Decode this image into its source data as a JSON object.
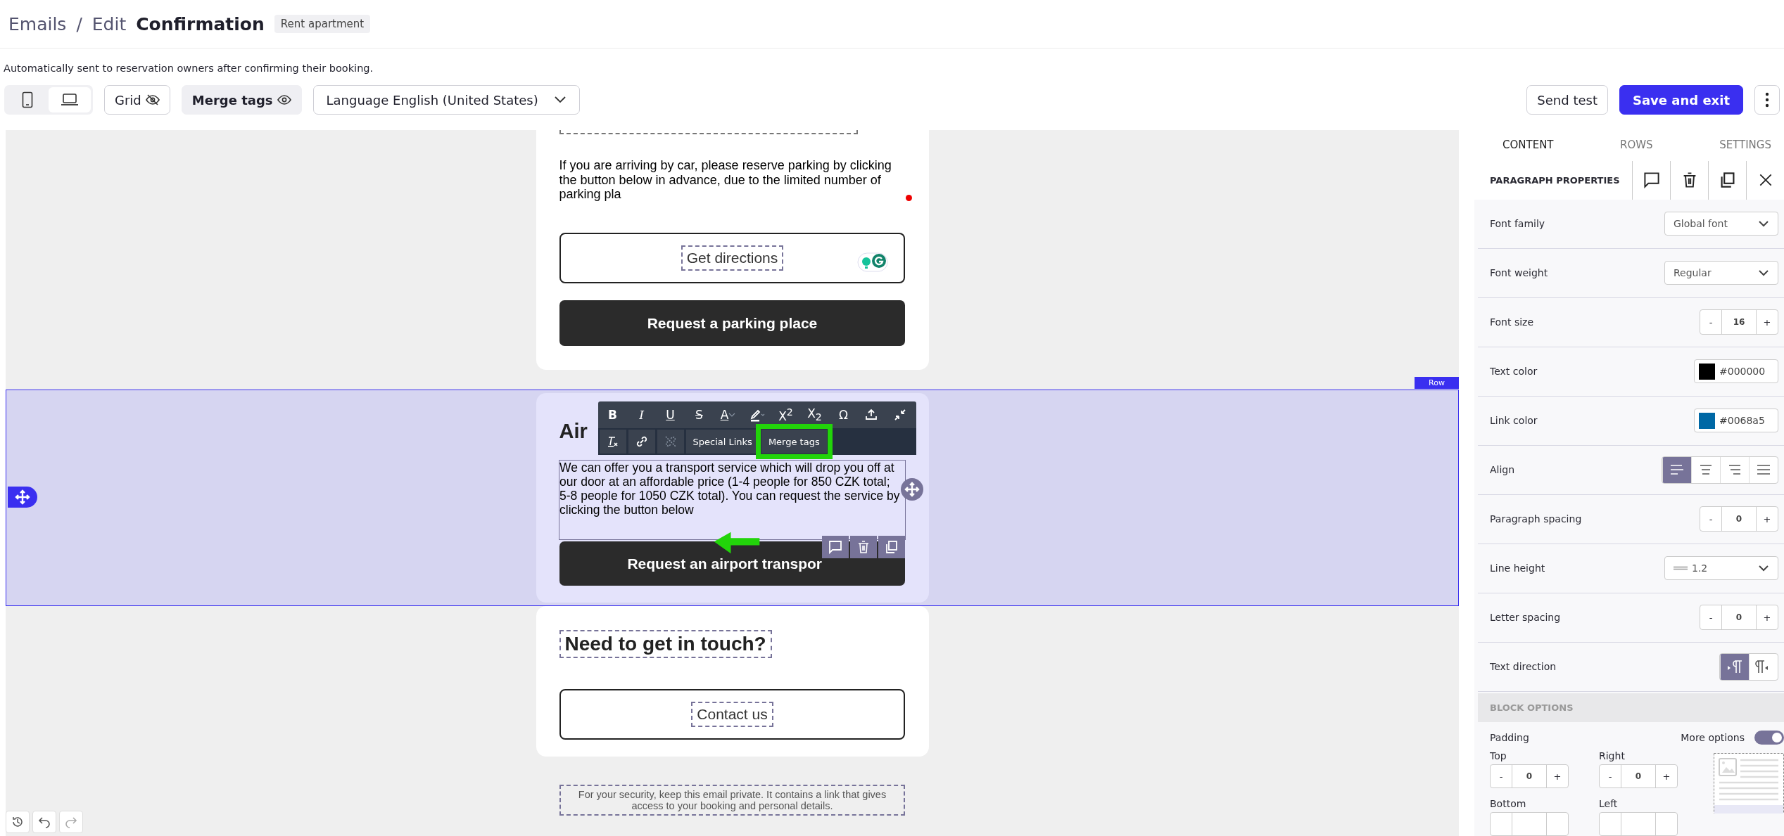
{
  "header": {
    "breadcrumb": [
      "Emails",
      "/",
      "Edit"
    ],
    "title": "Confirmation",
    "tag": "Rent apartment",
    "description": "Automatically sent to reservation owners after confirming their booking."
  },
  "toolbar": {
    "views": [
      {
        "kind": "mobile",
        "selected": false
      },
      {
        "kind": "desktop",
        "selected": true
      }
    ],
    "grid": {
      "label": "Grid",
      "on": false
    },
    "merge_tags": {
      "label": "Merge tags",
      "on": true
    },
    "language": "Language English (United States)",
    "send_test": "Send test",
    "save": "Save and exit"
  },
  "canvas": {
    "parking_text": "If you are arriving by car, please reserve parking by clicking the button below in advance, due to the limited number of parking pla",
    "directions_button": "Get directions",
    "parking_button": "Request a parking place",
    "row_label": "Row",
    "airport_heading": "Air",
    "airport_text": "We can offer you a transport service which will drop you off at our door at an affordable price (1-4 people for 850 CZK total; 5-8 people for 1050 CZK total). You can request the service by clicking the button below",
    "airport_button": "Request an airport transpor",
    "contact_heading": "Need to get in touch?",
    "contact_button": "Contact us",
    "footer_note": "For your security, keep this email private. It contains a link that gives access to your booking and personal details."
  },
  "format_toolbar": {
    "row_1": [
      {
        "kind": "bold",
        "label": "B"
      },
      {
        "kind": "italic",
        "label": "I"
      },
      {
        "kind": "underline",
        "label": "U"
      },
      {
        "kind": "strike",
        "label": "S"
      },
      {
        "kind": "text-color",
        "label": "A"
      },
      {
        "kind": "highlight"
      },
      {
        "kind": "superscript",
        "label": "X$^{2}$"
      },
      {
        "kind": "subscript",
        "label": "X$_{2}$"
      },
      {
        "kind": "special-char",
        "label": "Ω"
      },
      {
        "kind": "insert"
      },
      {
        "kind": "collapse"
      }
    ],
    "row_2": [
      {
        "kind": "clear"
      },
      {
        "kind": "link"
      },
      {
        "kind": "unlink"
      },
      {
        "kind": "text",
        "label": "Special Links",
        "highlighted": false
      },
      {
        "kind": "text",
        "label": "Merge tags",
        "highlighted": true
      }
    ]
  },
  "panel": {
    "tabs": [
      {
        "label": "CONTENT",
        "selected": true
      },
      {
        "label": "ROWS",
        "selected": false
      },
      {
        "label": "SETTINGS",
        "selected": false
      }
    ],
    "title": "PARAGRAPH PROPERTIES",
    "properties": [
      {
        "kind": "select",
        "label": "Font family",
        "value": "Global font"
      },
      {
        "kind": "select",
        "label": "Font weight",
        "value": "Regular"
      },
      {
        "kind": "stepper",
        "label": "Font size",
        "value": "16",
        "decrement": "-",
        "increment": "+"
      },
      {
        "kind": "color",
        "label": "Text color",
        "value": "#000000"
      },
      {
        "kind": "color",
        "label": "Link color",
        "value": "#0068a5"
      },
      {
        "kind": "align",
        "label": "Align",
        "options": [
          {
            "selected": true
          },
          {
            "selected": false
          },
          {
            "selected": false
          },
          {
            "selected": false
          }
        ]
      },
      {
        "kind": "stepper",
        "label": "Paragraph spacing",
        "value": "0",
        "decrement": "-",
        "increment": "+"
      },
      {
        "kind": "lineheight",
        "label": "Line height",
        "value": "1.2"
      },
      {
        "kind": "stepper",
        "label": "Letter spacing",
        "value": "0",
        "decrement": "-",
        "increment": "+"
      },
      {
        "kind": "direction",
        "label": "Text direction",
        "options": [
          {
            "selected": true
          },
          {
            "selected": false
          }
        ]
      }
    ],
    "block_options": "BLOCK OPTIONS",
    "padding": {
      "label": "Padding",
      "more_options": "More options",
      "more_on": true,
      "fields": [
        {
          "label": "Top",
          "value": "0",
          "decrement": "-",
          "increment": "+"
        },
        {
          "label": "Right",
          "value": "0",
          "decrement": "-",
          "increment": "+"
        },
        {
          "label": "Bottom"
        },
        {
          "label": "Left"
        }
      ]
    }
  }
}
